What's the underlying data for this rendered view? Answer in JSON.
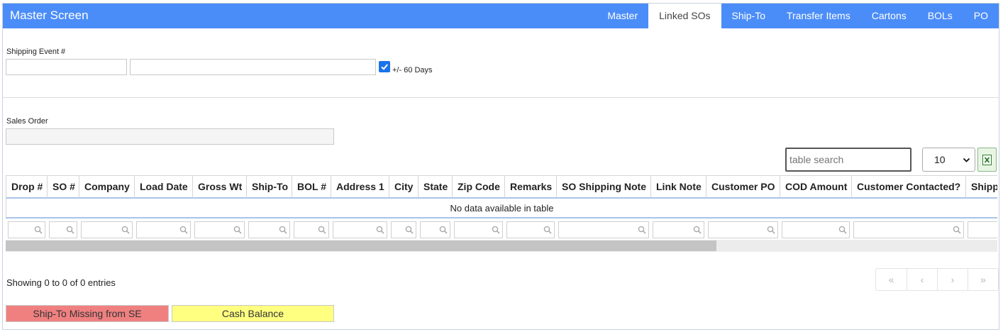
{
  "app": {
    "title": "Master Screen"
  },
  "nav": {
    "tabs": [
      {
        "label": "Master"
      },
      {
        "label": "Linked SOs",
        "active": true
      },
      {
        "label": "Ship-To"
      },
      {
        "label": "Transfer Items"
      },
      {
        "label": "Cartons"
      },
      {
        "label": "BOLs"
      },
      {
        "label": "PO"
      }
    ]
  },
  "form": {
    "shipping_event_label": "Shipping Event #",
    "shipping_event_value": "",
    "shipping_event_desc_value": "",
    "days_checkbox_checked": true,
    "days_checkbox_label": "+/- 60 Days",
    "sales_order_label": "Sales Order",
    "sales_order_value": ""
  },
  "table": {
    "search_placeholder": "table search",
    "page_size": "10",
    "export_icon": "excel-icon",
    "columns": [
      "Drop #",
      "SO #",
      "Company",
      "Load Date",
      "Gross Wt",
      "Ship-To",
      "BOL #",
      "Address 1",
      "City",
      "State",
      "Zip Code",
      "Remarks",
      "SO Shipping Note",
      "Link Note",
      "Customer PO",
      "COD Amount",
      "Customer Contacted?",
      "Shipp"
    ],
    "empty_message": "No data available in table",
    "info": "Showing 0 to 0 of 0 entries",
    "pager": [
      "«",
      "‹",
      "›",
      "»"
    ]
  },
  "legend": [
    {
      "label": "Ship-To Missing from SE",
      "color": "#f08080"
    },
    {
      "label": "Cash Balance",
      "color": "#ffff80"
    }
  ],
  "colors": {
    "header_bg": "#4b8df8",
    "accent": "#1a73e8"
  }
}
